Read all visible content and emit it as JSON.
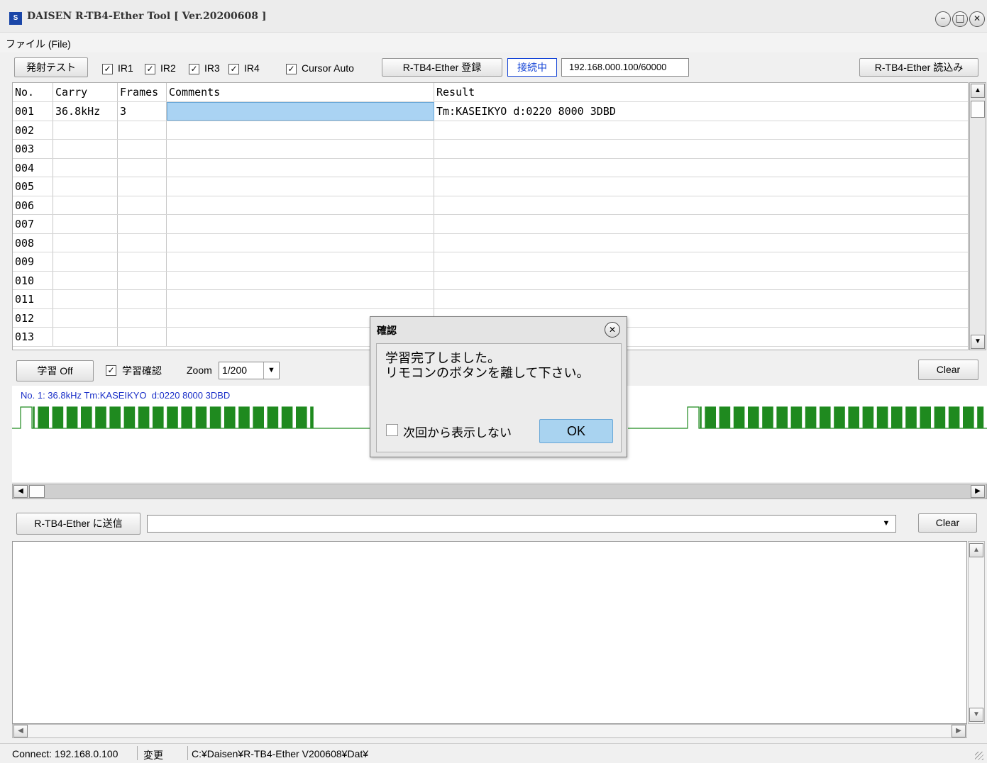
{
  "window": {
    "title": "DAISEN R-TB4-Ether Tool [ Ver.20200608 ]",
    "icon_text": "S",
    "min_glyph": "–",
    "max_glyph": "□",
    "close_glyph": "✕"
  },
  "menu": {
    "file": "ファイル (File)"
  },
  "toolbar": {
    "emit_test": "発射テスト",
    "ir1": "IR1",
    "ir2": "IR2",
    "ir3": "IR3",
    "ir4": "IR4",
    "cursor_auto": "Cursor Auto",
    "register": "R-TB4-Ether 登録",
    "connected": "接続中",
    "address": "192.168.000.100/60000",
    "read": "R-TB4-Ether 読込み"
  },
  "grid": {
    "headers": [
      "No.",
      "Carry",
      "Frames",
      "Comments",
      "Result"
    ],
    "rows": [
      [
        "001",
        "36.8kHz",
        "3",
        "",
        "Tm:KASEIKYO   d:0220 8000 3DBD"
      ],
      [
        "002",
        "",
        "",
        "",
        ""
      ],
      [
        "003",
        "",
        "",
        "",
        ""
      ],
      [
        "004",
        "",
        "",
        "",
        ""
      ],
      [
        "005",
        "",
        "",
        "",
        ""
      ],
      [
        "006",
        "",
        "",
        "",
        ""
      ],
      [
        "007",
        "",
        "",
        "",
        ""
      ],
      [
        "008",
        "",
        "",
        "",
        ""
      ],
      [
        "009",
        "",
        "",
        "",
        ""
      ],
      [
        "010",
        "",
        "",
        "",
        ""
      ],
      [
        "011",
        "",
        "",
        "",
        ""
      ],
      [
        "012",
        "",
        "",
        "",
        ""
      ],
      [
        "013",
        "",
        "",
        "",
        ""
      ]
    ]
  },
  "learn": {
    "toggle": "学習 Off",
    "confirm": "学習確認",
    "zoom_label": "Zoom",
    "zoom_value": "1/200",
    "clear": "Clear",
    "caption": "No. 1: 36.8kHz Tm:KASEIKYO  d:0220 8000 3DBD"
  },
  "send": {
    "button": "R-TB4-Ether に送信",
    "input_value": "",
    "clear": "Clear"
  },
  "status": {
    "connect": "Connect: 192.168.0.100",
    "change": "変更",
    "path": "C:¥Daisen¥R-TB4-Ether V200608¥Dat¥"
  },
  "dialog": {
    "title": "確認",
    "line1": "学習完了しました。",
    "line2": "リモコンのボタンを離して下さい。",
    "dont_show": "次回から表示しない",
    "ok": "OK"
  },
  "colors": {
    "selection": "#aad3f3",
    "wave": "#1f8a1f",
    "caption": "#1a2fc8",
    "connected": "#1545d6"
  }
}
